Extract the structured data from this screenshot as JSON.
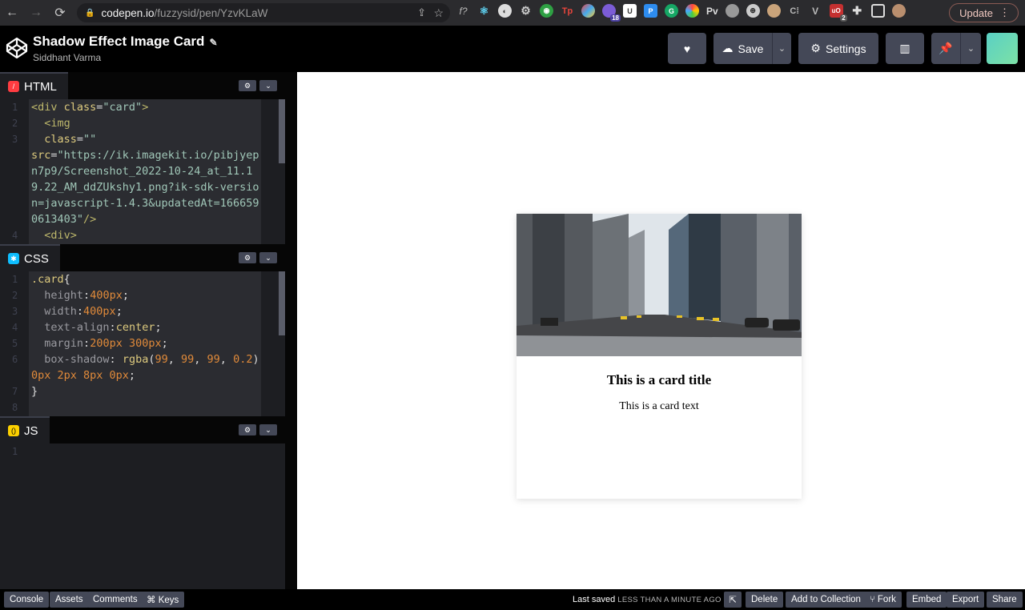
{
  "browser": {
    "url_host": "codepen.io",
    "url_path": "/fuzzysid/pen/YzvKLaW",
    "update_label": "Update",
    "ext_badge_1": "18",
    "ext_badge_2": "2"
  },
  "header": {
    "title": "Shadow Effect Image Card",
    "author": "Siddhant Varma",
    "save_label": "Save",
    "settings_label": "Settings"
  },
  "editors": {
    "html": {
      "label": "HTML",
      "line_numbers": [
        "1",
        "2",
        "3",
        "",
        "",
        "",
        "",
        "",
        "4"
      ],
      "code": [
        {
          "t": "<div ",
          "c": "t-tag"
        },
        {
          "t": "class",
          "c": "t-attr"
        },
        {
          "t": "=",
          "c": ""
        },
        {
          "t": "\"card\"",
          "c": "t-str"
        },
        {
          "t": ">\n  ",
          "c": "t-tag"
        },
        {
          "t": "<img\n  ",
          "c": "t-tag"
        },
        {
          "t": "class",
          "c": "t-attr"
        },
        {
          "t": "=",
          "c": ""
        },
        {
          "t": "\"\"\n",
          "c": "t-str"
        },
        {
          "t": "src",
          "c": "t-attr"
        },
        {
          "t": "=",
          "c": ""
        },
        {
          "t": "\"https://ik.imagekit.io/pibjyepn7p9/Screenshot_2022-10-24_at_11.19.22_AM_ddZUkshy1.png?ik-sdk-version=javascript-1.4.3&updatedAt=1666590613403\"",
          "c": "t-str"
        },
        {
          "t": "/>\n  ",
          "c": "t-tag"
        },
        {
          "t": "<div>",
          "c": "t-tag"
        }
      ]
    },
    "css": {
      "label": "CSS",
      "line_numbers": [
        "1",
        "2",
        "3",
        "4",
        "5",
        "6",
        "",
        "7",
        "8"
      ],
      "code": [
        {
          "t": ".card",
          "c": "t-sel"
        },
        {
          "t": "{\n  ",
          "c": ""
        },
        {
          "t": "height",
          "c": "t-prop"
        },
        {
          "t": ":",
          "c": ""
        },
        {
          "t": "400px",
          "c": "t-num"
        },
        {
          "t": ";\n  ",
          "c": ""
        },
        {
          "t": "width",
          "c": "t-prop"
        },
        {
          "t": ":",
          "c": ""
        },
        {
          "t": "400px",
          "c": "t-num"
        },
        {
          "t": ";\n  ",
          "c": ""
        },
        {
          "t": "text-align",
          "c": "t-prop"
        },
        {
          "t": ":",
          "c": ""
        },
        {
          "t": "center",
          "c": "t-kw"
        },
        {
          "t": ";\n  ",
          "c": ""
        },
        {
          "t": "margin",
          "c": "t-prop"
        },
        {
          "t": ":",
          "c": ""
        },
        {
          "t": "200px 300px",
          "c": "t-num"
        },
        {
          "t": ";\n  ",
          "c": ""
        },
        {
          "t": "box-shadow",
          "c": "t-prop"
        },
        {
          "t": ": ",
          "c": ""
        },
        {
          "t": "rgba",
          "c": "t-kw"
        },
        {
          "t": "(",
          "c": ""
        },
        {
          "t": "99",
          "c": "t-num"
        },
        {
          "t": ", ",
          "c": ""
        },
        {
          "t": "99",
          "c": "t-num"
        },
        {
          "t": ", ",
          "c": ""
        },
        {
          "t": "99",
          "c": "t-num"
        },
        {
          "t": ", ",
          "c": ""
        },
        {
          "t": "0.2",
          "c": "t-num"
        },
        {
          "t": ")\n",
          "c": ""
        },
        {
          "t": "0px 2px 8px 0px",
          "c": "t-num"
        },
        {
          "t": ";\n",
          "c": ""
        },
        {
          "t": "}",
          "c": ""
        }
      ]
    },
    "js": {
      "label": "JS",
      "line_numbers": [
        "1"
      ],
      "code": []
    }
  },
  "preview": {
    "card_title": "This is a card title",
    "card_text": "This is a card text"
  },
  "footer": {
    "console": "Console",
    "assets": "Assets",
    "comments": "Comments",
    "keys": "⌘ Keys",
    "last_saved_label": "Last saved",
    "last_saved_ago": "LESS THAN A MINUTE AGO",
    "delete": "Delete",
    "add_to_collection": "Add to Collection",
    "fork": "Fork",
    "embed": "Embed",
    "export": "Export",
    "share": "Share"
  },
  "colors": {
    "html_icon": "#ff3c41",
    "css_icon": "#0ebeff",
    "js_icon": "#fcd000",
    "button_bg": "#444857"
  }
}
